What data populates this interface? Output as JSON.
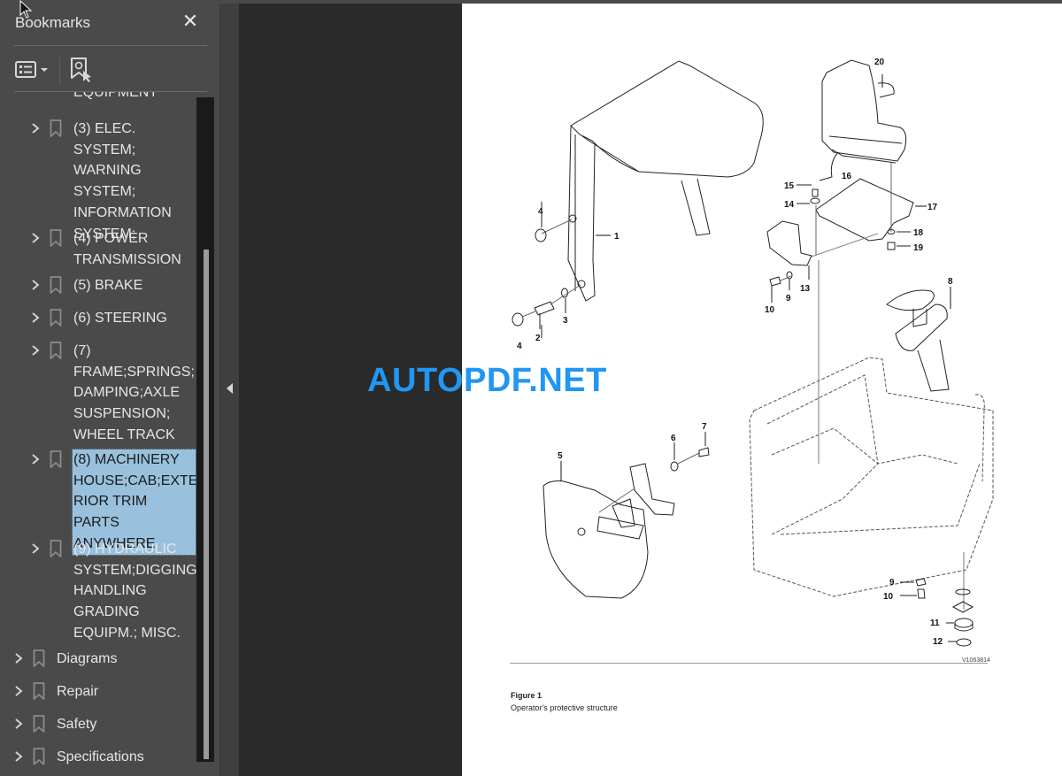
{
  "sidebar": {
    "title": "Bookmarks",
    "close_icon": "close-icon",
    "toolbar": {
      "options_icon": "list-options-icon",
      "find_icon": "find-bookmark-icon"
    },
    "cut_top_label": "EQUIPMENT",
    "items": [
      {
        "label": "(3) ELEC. SYSTEM;\nWARNING\nSYSTEM;\nINFORMATION\nSYSTEM;",
        "level": 2,
        "selected": false
      },
      {
        "label": "(4) POWER\nTRANSMISSION",
        "level": 2,
        "selected": false
      },
      {
        "label": "(5) BRAKE",
        "level": 2,
        "selected": false
      },
      {
        "label": "(6) STEERING",
        "level": 2,
        "selected": false
      },
      {
        "label": "(7)\nFRAME;SPRINGS;\nDAMPING;AXLE\nSUSPENSION;\nWHEEL TRACK",
        "level": 2,
        "selected": false
      },
      {
        "label": "(8) MACHINERY\nHOUSE;CAB;EXTE\nRIOR TRIM PARTS\nANYWHERE",
        "level": 2,
        "selected": true
      },
      {
        "label": "(9) HYDRAULIC\nSYSTEM;DIGGING\nHANDLING\nGRADING\nEQUIPM.; MISC.",
        "level": 2,
        "selected": false
      },
      {
        "label": "Diagrams",
        "level": 1,
        "selected": false
      },
      {
        "label": "Repair",
        "level": 1,
        "selected": false
      },
      {
        "label": "Safety",
        "level": 1,
        "selected": false
      },
      {
        "label": "Specifications",
        "level": 1,
        "selected": false
      }
    ]
  },
  "document": {
    "figure_title": "Figure 1",
    "figure_caption": "Operator's protective structure",
    "figure_code": "V1063814",
    "callouts": [
      "1",
      "2",
      "3",
      "4",
      "4",
      "5",
      "6",
      "7",
      "8",
      "9",
      "10",
      "9",
      "10",
      "11",
      "12",
      "13",
      "14",
      "15",
      "16",
      "17",
      "18",
      "19",
      "20"
    ]
  },
  "watermark": "AUTOPDF.NET",
  "colors": {
    "selection": "#99c1de",
    "watermark": "#2196f3",
    "sidebar_bg": "#4a4a4a",
    "viewer_bg": "#2a2a2a"
  }
}
